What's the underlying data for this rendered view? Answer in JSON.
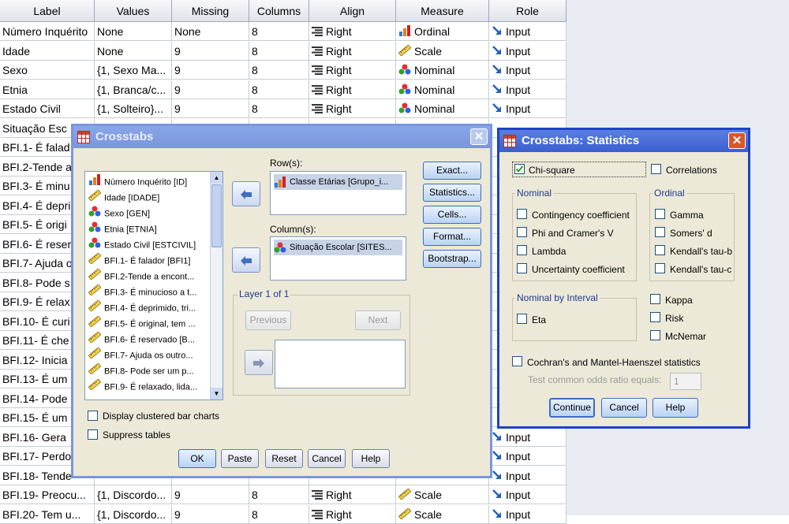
{
  "grid": {
    "headers": [
      "Label",
      "Values",
      "Missing",
      "Columns",
      "Align",
      "Measure",
      "Role"
    ],
    "rows": [
      {
        "label": "Número Inquérito",
        "values": "None",
        "missing": "None",
        "columns": "8",
        "align": "Right",
        "measure": "Ordinal",
        "role": "Input"
      },
      {
        "label": "Idade",
        "values": "None",
        "missing": "9",
        "columns": "8",
        "align": "Right",
        "measure": "Scale",
        "role": "Input"
      },
      {
        "label": "Sexo",
        "values": "{1, Sexo Ma...",
        "missing": "9",
        "columns": "8",
        "align": "Right",
        "measure": "Nominal",
        "role": "Input"
      },
      {
        "label": "Etnia",
        "values": "{1, Branca/c...",
        "missing": "9",
        "columns": "8",
        "align": "Right",
        "measure": "Nominal",
        "role": "Input"
      },
      {
        "label": "Estado Civil",
        "values": "{1, Solteiro}...",
        "missing": "9",
        "columns": "8",
        "align": "Right",
        "measure": "Nominal",
        "role": "Input"
      },
      {
        "label": "Situação Esc",
        "values": "",
        "missing": "",
        "columns": "",
        "align": "",
        "measure": "",
        "role": ""
      },
      {
        "label": "BFI.1- É falad",
        "values": "",
        "missing": "",
        "columns": "",
        "align": "",
        "measure": "",
        "role": ""
      },
      {
        "label": "BFI.2-Tende a",
        "values": "",
        "missing": "",
        "columns": "",
        "align": "",
        "measure": "",
        "role": ""
      },
      {
        "label": "BFI.3- É minu",
        "values": "",
        "missing": "",
        "columns": "",
        "align": "",
        "measure": "",
        "role": ""
      },
      {
        "label": "BFI.4- É depri",
        "values": "",
        "missing": "",
        "columns": "",
        "align": "",
        "measure": "",
        "role": ""
      },
      {
        "label": "BFI.5- É origi",
        "values": "",
        "missing": "",
        "columns": "",
        "align": "",
        "measure": "",
        "role": ""
      },
      {
        "label": "BFI.6- É reser",
        "values": "",
        "missing": "",
        "columns": "",
        "align": "",
        "measure": "",
        "role": ""
      },
      {
        "label": "BFI.7- Ajuda o",
        "values": "",
        "missing": "",
        "columns": "",
        "align": "",
        "measure": "",
        "role": ""
      },
      {
        "label": "BFI.8- Pode s",
        "values": "",
        "missing": "",
        "columns": "",
        "align": "",
        "measure": "",
        "role": ""
      },
      {
        "label": "BFI.9- É relax",
        "values": "",
        "missing": "",
        "columns": "",
        "align": "",
        "measure": "",
        "role": ""
      },
      {
        "label": "BFI.10- É curi",
        "values": "",
        "missing": "",
        "columns": "",
        "align": "",
        "measure": "",
        "role": ""
      },
      {
        "label": "BFI.11- É che",
        "values": "",
        "missing": "",
        "columns": "",
        "align": "",
        "measure": "",
        "role": ""
      },
      {
        "label": "BFI.12- Inicia",
        "values": "",
        "missing": "",
        "columns": "",
        "align": "",
        "measure": "",
        "role": ""
      },
      {
        "label": "BFI.13- É um",
        "values": "",
        "missing": "",
        "columns": "",
        "align": "",
        "measure": "",
        "role": ""
      },
      {
        "label": "BFI.14- Pode",
        "values": "",
        "missing": "",
        "columns": "",
        "align": "",
        "measure": "",
        "role": ""
      },
      {
        "label": "BFI.15- É um",
        "values": "",
        "missing": "",
        "columns": "",
        "align": "",
        "measure": "",
        "role": ""
      },
      {
        "label": "BFI.16- Gera",
        "values": "",
        "missing": "",
        "columns": "",
        "align": "",
        "measure": "",
        "role": "Input"
      },
      {
        "label": "BFI.17- Perdo",
        "values": "",
        "missing": "",
        "columns": "",
        "align": "",
        "measure": "",
        "role": "Input"
      },
      {
        "label": "BFI.18- Tende",
        "values": "",
        "missing": "",
        "columns": "",
        "align": "",
        "measure": "",
        "role": "Input"
      },
      {
        "label": "BFI.19- Preocu...",
        "values": "{1, Discordo...",
        "missing": "9",
        "columns": "8",
        "align": "Right",
        "measure": "Scale",
        "role": "Input"
      },
      {
        "label": "BFI.20- Tem u...",
        "values": "{1, Discordo...",
        "missing": "9",
        "columns": "8",
        "align": "Right",
        "measure": "Scale",
        "role": "Input"
      }
    ]
  },
  "crosstabs": {
    "title": "Crosstabs",
    "variables": [
      {
        "name": "Número Inquérito [ID]",
        "type": "ordinal"
      },
      {
        "name": "Idade [IDADE]",
        "type": "scale"
      },
      {
        "name": "Sexo [GEN]",
        "type": "nominal"
      },
      {
        "name": "Etnia [ETNIA]",
        "type": "nominal"
      },
      {
        "name": "Estado Civil [ESTCIVIL]",
        "type": "nominal"
      },
      {
        "name": "BFI.1- É falador [BFI1]",
        "type": "scale"
      },
      {
        "name": "BFI.2-Tende a encont...",
        "type": "scale"
      },
      {
        "name": "BFI.3- É minucioso a t...",
        "type": "scale"
      },
      {
        "name": "BFI.4- É deprimido, tri...",
        "type": "scale"
      },
      {
        "name": "BFI.5- É original, tem ...",
        "type": "scale"
      },
      {
        "name": "BFI.6- É reservado [B...",
        "type": "scale"
      },
      {
        "name": "BFI.7- Ajuda os outro...",
        "type": "scale"
      },
      {
        "name": "BFI.8- Pode ser um p...",
        "type": "scale"
      },
      {
        "name": "BFI.9- É relaxado, lida...",
        "type": "scale"
      }
    ],
    "rows_label": "Row(s):",
    "row_item": "Classe Etárias [Grupo_i...",
    "columns_label": "Column(s):",
    "column_item": "Situação Escolar [SITES...",
    "layer_label": "Layer 1 of 1",
    "previous": "Previous",
    "next": "Next",
    "side_buttons": [
      "Exact...",
      "Statistics...",
      "Cells...",
      "Format...",
      "Bootstrap..."
    ],
    "display_clustered": "Display clustered bar charts",
    "suppress_tables": "Suppress tables",
    "bottom_buttons": [
      "OK",
      "Paste",
      "Reset",
      "Cancel",
      "Help"
    ]
  },
  "statistics": {
    "title": "Crosstabs: Statistics",
    "chi_square": "Chi-square",
    "correlations": "Correlations",
    "nominal_group": "Nominal",
    "nominal_items": [
      "Contingency coefficient",
      "Phi and Cramer's V",
      "Lambda",
      "Uncertainty coefficient"
    ],
    "ordinal_group": "Ordinal",
    "ordinal_items": [
      "Gamma",
      "Somers' d",
      "Kendall's tau-b",
      "Kendall's tau-c"
    ],
    "nbi_group": "Nominal by Interval",
    "eta": "Eta",
    "other_items": [
      "Kappa",
      "Risk",
      "McNemar"
    ],
    "cochran": "Cochran's and Mantel-Haenszel statistics",
    "test_odds_label": "Test common odds ratio equals:",
    "test_odds_value": "1",
    "buttons": [
      "Continue",
      "Cancel",
      "Help"
    ]
  }
}
